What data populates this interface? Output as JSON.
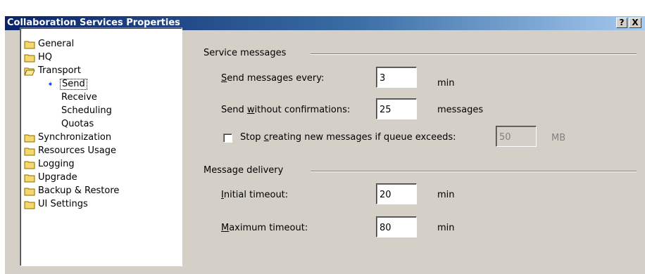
{
  "window": {
    "title": "Collaboration Services Properties"
  },
  "title_buttons": {
    "help": "?",
    "close": "X"
  },
  "tree": {
    "items": [
      {
        "label": "General"
      },
      {
        "label": "HQ"
      },
      {
        "label": "Transport"
      },
      {
        "label": "Send"
      },
      {
        "label": "Receive"
      },
      {
        "label": "Scheduling"
      },
      {
        "label": "Quotas"
      },
      {
        "label": "Synchronization"
      },
      {
        "label": "Resources Usage"
      },
      {
        "label": "Logging"
      },
      {
        "label": "Upgrade"
      },
      {
        "label": "Backup & Restore"
      },
      {
        "label": "UI Settings"
      }
    ]
  },
  "service_messages": {
    "heading": "Service messages",
    "send_every": {
      "label_key": "S",
      "label_rest": "end messages every:",
      "value": "3",
      "unit": "min"
    },
    "send_without": {
      "label_pre": "Send ",
      "label_key": "w",
      "label_rest": "ithout confirmations:",
      "value": "25",
      "unit": "messages"
    },
    "stop_creating": {
      "label_pre": "Stop ",
      "label_key": "c",
      "label_rest": "reating new messages if queue exceeds:",
      "checked": false,
      "value": "50",
      "unit": "MB"
    }
  },
  "message_delivery": {
    "heading": "Message delivery",
    "initial": {
      "label_key": "I",
      "label_rest": "nitial timeout:",
      "value": "20",
      "unit": "min"
    },
    "maximum": {
      "label_key": "M",
      "label_rest": "aximum timeout:",
      "value": "80",
      "unit": "min"
    }
  }
}
